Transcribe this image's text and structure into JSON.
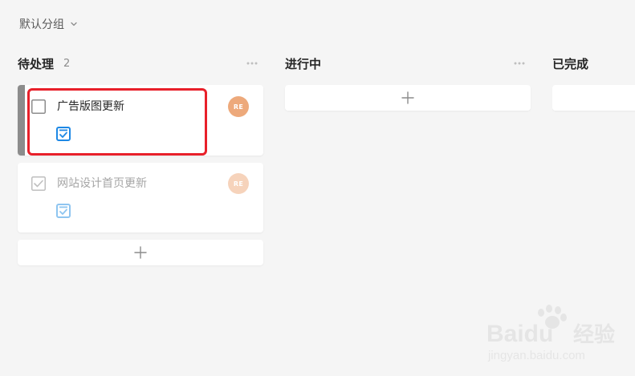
{
  "group_switch": {
    "label": "默认分组"
  },
  "columns": [
    {
      "title": "待处理",
      "count": "2",
      "cards": [
        {
          "title": "广告版图更新",
          "completed": false,
          "avatar_initials": "RE",
          "avatar_color": "#eda97b"
        },
        {
          "title": "网站设计首页更新",
          "completed": true,
          "avatar_initials": "RE",
          "avatar_color": "#f6d3bb"
        }
      ]
    },
    {
      "title": "进行中",
      "cards": []
    },
    {
      "title": "已完成",
      "cards": []
    }
  ],
  "colors": {
    "accent_blue": "#1e88e5",
    "highlight_red": "#e8202a",
    "card_bar_gray": "#8c8c8c"
  },
  "watermark": {
    "brand": "Baidu",
    "brand_cn": "经验",
    "url": "jingyan.baidu.com"
  }
}
